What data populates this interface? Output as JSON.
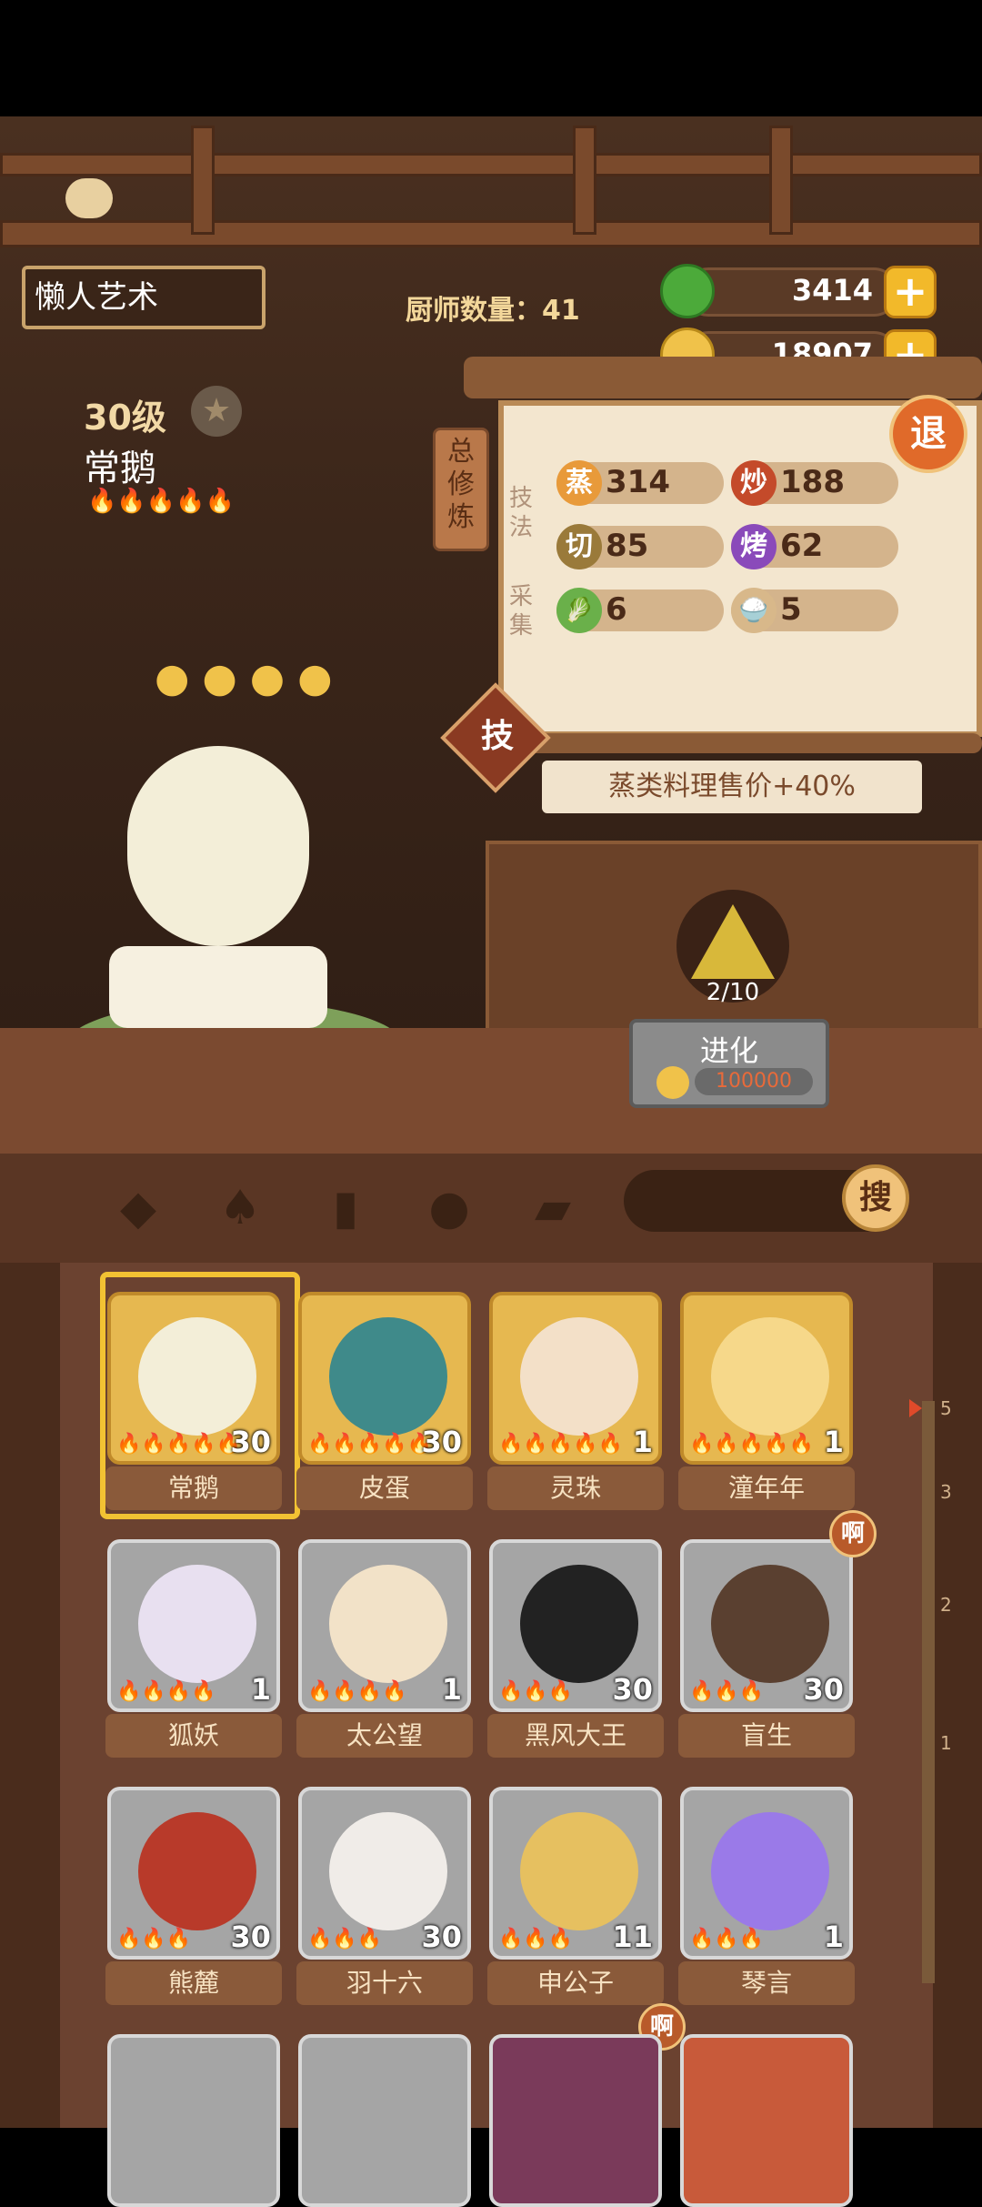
{
  "header": {
    "title": "懒人艺术",
    "chef_count_label": "厨师数量：41"
  },
  "resources": {
    "jade": "3414",
    "coins": "18907",
    "plus": "+"
  },
  "chef": {
    "level": "30级",
    "name": "常鹅",
    "fires": "🔥🔥🔥🔥🔥"
  },
  "side_buttons": {
    "exit": "退",
    "total_train": "总修炼",
    "skill": "技"
  },
  "stats": {
    "technique_label": "技法",
    "gather_label": "采集",
    "steam": {
      "icon": "蒸",
      "value": "314"
    },
    "fry": {
      "icon": "炒",
      "value": "188"
    },
    "cut": {
      "icon": "切",
      "value": "85"
    },
    "roast": {
      "icon": "烤",
      "value": "62"
    },
    "veg": {
      "icon": "🥬",
      "value": "6"
    },
    "grain": {
      "icon": "🍚",
      "value": "5"
    }
  },
  "bonus_banner": "蒸类料理售价+40%",
  "evolve": {
    "progress": "2/10",
    "label": "进化",
    "cost": "100000"
  },
  "toolbar": {
    "search_label": "搜"
  },
  "cards": [
    {
      "name": "常鹅",
      "level": "30",
      "fires": "🔥🔥🔥🔥🔥",
      "gold": true
    },
    {
      "name": "皮蛋",
      "level": "30",
      "fires": "🔥🔥🔥🔥🔥",
      "gold": true
    },
    {
      "name": "灵珠",
      "level": "1",
      "fires": "🔥🔥🔥🔥🔥",
      "gold": true
    },
    {
      "name": "潼年年",
      "level": "1",
      "fires": "🔥🔥🔥🔥🔥",
      "gold": true
    },
    {
      "name": "狐妖",
      "level": "1",
      "fires": "🔥🔥🔥🔥",
      "gold": false
    },
    {
      "name": "太公望",
      "level": "1",
      "fires": "🔥🔥🔥🔥",
      "gold": false
    },
    {
      "name": "黑风大王",
      "level": "30",
      "fires": "🔥🔥🔥",
      "gold": false
    },
    {
      "name": "盲生",
      "level": "30",
      "fires": "🔥🔥🔥",
      "gold": false
    },
    {
      "name": "熊麓",
      "level": "30",
      "fires": "🔥🔥🔥",
      "gold": false
    },
    {
      "name": "羽十六",
      "level": "30",
      "fires": "🔥🔥🔥",
      "gold": false
    },
    {
      "name": "申公子",
      "level": "11",
      "fires": "🔥🔥🔥",
      "gold": false
    },
    {
      "name": "琴言",
      "level": "1",
      "fires": "🔥🔥🔥",
      "gold": false
    }
  ],
  "badges": {
    "a": "啊"
  },
  "rail_marks": [
    "5",
    "3",
    "2",
    "1"
  ],
  "colors": {
    "gold_card": "#e6b850",
    "gray_card": "#a5a5a5",
    "accent": "#f2b92a"
  }
}
